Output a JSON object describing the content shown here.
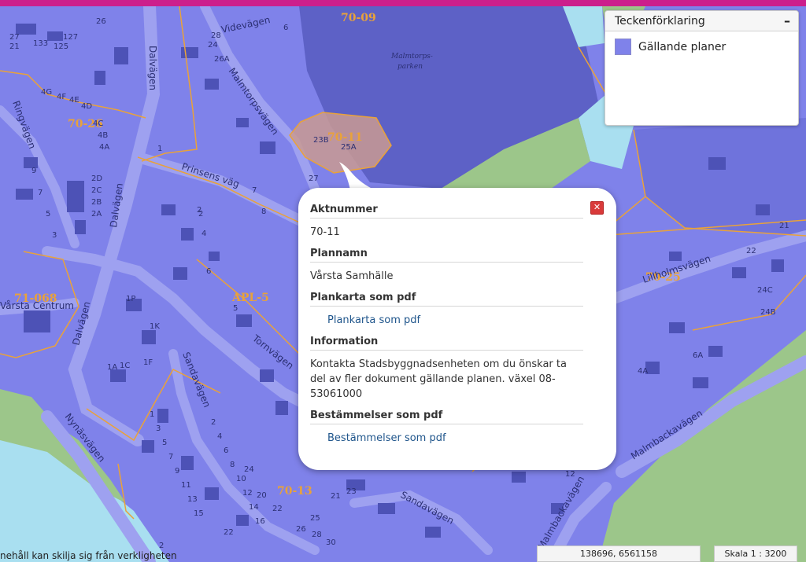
{
  "map": {
    "plan_labels": [
      "70-09",
      "70-26",
      "70-11",
      "APL-5",
      "71-068",
      "70-13",
      "70-25"
    ],
    "street_labels": [
      "Videvägen",
      "Dalvägen",
      "Malmtorpsvägen",
      "Ringvägen",
      "Prinsens väg",
      "Dalvägen",
      "Dalvägen",
      "Tornvägen",
      "Sandavägen",
      "Nynäsvägen",
      "Lillholmsvägen",
      "Malmbackavägen",
      "Sandavägen",
      "Malmbackavägen"
    ],
    "place_labels": [
      "Malmtorps-",
      "parken",
      "Vårsta Centrum"
    ],
    "address_labels": [
      "27",
      "21",
      "133",
      "125",
      "127",
      "26",
      "6",
      "24",
      "26A",
      "28",
      "4G",
      "4F",
      "4E",
      "4D",
      "4C",
      "4B",
      "4A",
      "23B",
      "25A",
      "27",
      "1",
      "2",
      "9",
      "7",
      "5",
      "3",
      "2D",
      "2C",
      "2B",
      "2A",
      "7",
      "8",
      "2",
      "4",
      "6",
      "5",
      "1P",
      "1K",
      "1A",
      "1C",
      "1F",
      "1",
      "3",
      "5",
      "7",
      "9",
      "11",
      "13",
      "15",
      "2",
      "4",
      "6",
      "8",
      "10",
      "12",
      "14",
      "16",
      "22",
      "24",
      "20",
      "22",
      "25",
      "26",
      "28",
      "30",
      "21",
      "23",
      "22",
      "21",
      "24C",
      "24B",
      "4A",
      "6A",
      "12",
      "2"
    ],
    "footer_note": "nehåll kan skilja sig från verkligheten",
    "coordinates": "138696, 6561158",
    "scale": "Skala 1 : 3200",
    "colors": {
      "plan_fill": "#7f82ea",
      "plan_border": "#e9a23a",
      "selected_plan": "#c99a92",
      "park_green": "#9cc68a",
      "water": "#a9dff0",
      "top_bar": "#cc1f8c"
    }
  },
  "legend": {
    "title": "Teckenförklaring",
    "minimize": "–",
    "items": [
      {
        "label": "Gällande planer",
        "color": "#7f82ea"
      }
    ]
  },
  "popup": {
    "close": "✕",
    "sections": [
      {
        "title": "Aktnummer",
        "value": "70-11"
      },
      {
        "title": "Plannamn",
        "value": "Vårsta Samhälle"
      },
      {
        "title": "Plankarta som pdf",
        "link": "Plankarta som pdf"
      },
      {
        "title": "Information",
        "value": "Kontakta Stadsbyggnadsenheten om du önskar ta del av fler dokument gällande planen. växel 08-53061000"
      },
      {
        "title": "Bestämmelser som pdf",
        "link": "Bestämmelser som pdf"
      }
    ]
  }
}
